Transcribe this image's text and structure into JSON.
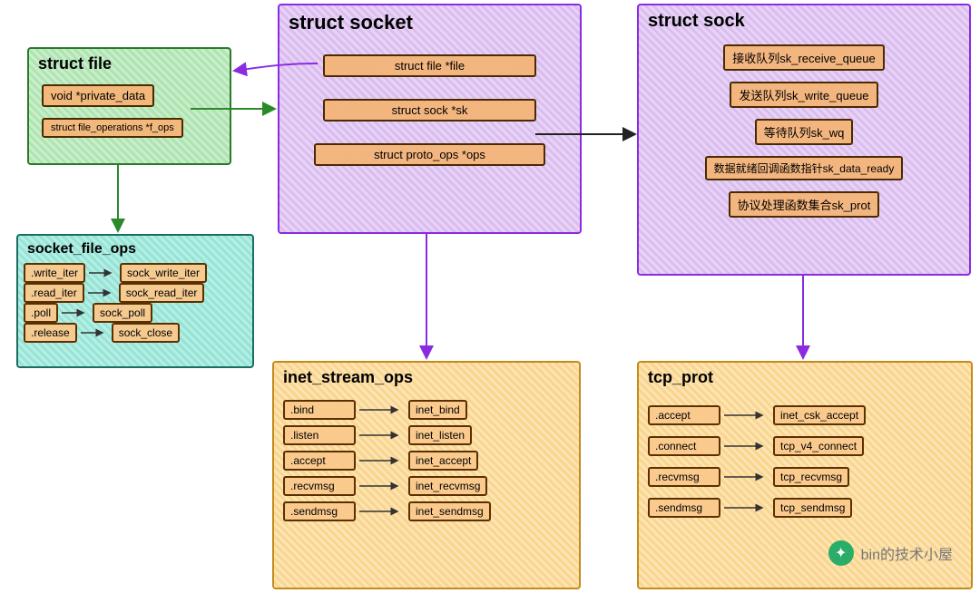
{
  "struct_file": {
    "title": "struct file",
    "fields": [
      "void *private_data",
      "struct file_operations *f_ops"
    ]
  },
  "socket_file_ops": {
    "title": "socket_file_ops",
    "map": [
      [
        ".write_iter",
        "sock_write_iter"
      ],
      [
        ".read_iter",
        "sock_read_iter"
      ],
      [
        ".poll",
        "sock_poll"
      ],
      [
        ".release",
        "sock_close"
      ]
    ]
  },
  "struct_socket": {
    "title": "struct socket",
    "fields": [
      "struct file *file",
      "struct sock *sk",
      "struct proto_ops *ops"
    ]
  },
  "struct_sock": {
    "title": "struct sock",
    "fields": [
      "接收队列sk_receive_queue",
      "发送队列sk_write_queue",
      "等待队列sk_wq",
      "数据就绪回调函数指针sk_data_ready",
      "协议处理函数集合sk_prot"
    ]
  },
  "inet_stream_ops": {
    "title": "inet_stream_ops",
    "map": [
      [
        ".bind",
        "inet_bind"
      ],
      [
        ".listen",
        "inet_listen"
      ],
      [
        ".accept",
        "inet_accept"
      ],
      [
        ".recvmsg",
        "inet_recvmsg"
      ],
      [
        ".sendmsg",
        "inet_sendmsg"
      ]
    ]
  },
  "tcp_prot": {
    "title": "tcp_prot",
    "map": [
      [
        ".accept",
        "inet_csk_accept"
      ],
      [
        ".connect",
        "tcp_v4_connect"
      ],
      [
        ".recvmsg",
        "tcp_recvmsg"
      ],
      [
        ".sendmsg",
        "tcp_sendmsg"
      ]
    ]
  },
  "watermark": "bin的技术小屋",
  "chart_data": {
    "type": "diagram",
    "nodes": [
      {
        "id": "struct_file",
        "label": "struct file",
        "fields": [
          "void *private_data",
          "struct file_operations *f_ops"
        ]
      },
      {
        "id": "socket_file_ops",
        "label": "socket_file_ops",
        "pairs": [
          [
            ".write_iter",
            "sock_write_iter"
          ],
          [
            ".read_iter",
            "sock_read_iter"
          ],
          [
            ".poll",
            "sock_poll"
          ],
          [
            ".release",
            "sock_close"
          ]
        ]
      },
      {
        "id": "struct_socket",
        "label": "struct socket",
        "fields": [
          "struct file *file",
          "struct sock *sk",
          "struct proto_ops *ops"
        ]
      },
      {
        "id": "struct_sock",
        "label": "struct sock",
        "fields": [
          "接收队列sk_receive_queue",
          "发送队列sk_write_queue",
          "等待队列sk_wq",
          "数据就绪回调函数指针sk_data_ready",
          "协议处理函数集合sk_prot"
        ]
      },
      {
        "id": "inet_stream_ops",
        "label": "inet_stream_ops",
        "pairs": [
          [
            ".bind",
            "inet_bind"
          ],
          [
            ".listen",
            "inet_listen"
          ],
          [
            ".accept",
            "inet_accept"
          ],
          [
            ".recvmsg",
            "inet_recvmsg"
          ],
          [
            ".sendmsg",
            "inet_sendmsg"
          ]
        ]
      },
      {
        "id": "tcp_prot",
        "label": "tcp_prot",
        "pairs": [
          [
            ".accept",
            "inet_csk_accept"
          ],
          [
            ".connect",
            "tcp_v4_connect"
          ],
          [
            ".recvmsg",
            "tcp_recvmsg"
          ],
          [
            ".sendmsg",
            "tcp_sendmsg"
          ]
        ]
      }
    ],
    "edges": [
      {
        "from": "struct_file.f_ops",
        "to": "socket_file_ops",
        "color": "green"
      },
      {
        "from": "struct_file.private_data",
        "to": "struct_socket",
        "color": "green"
      },
      {
        "from": "struct_socket.file",
        "to": "struct_file",
        "color": "purple"
      },
      {
        "from": "struct_socket.sk",
        "to": "struct_sock",
        "color": "black"
      },
      {
        "from": "struct_socket.ops",
        "to": "inet_stream_ops",
        "color": "purple"
      },
      {
        "from": "struct_sock.sk_prot",
        "to": "tcp_prot",
        "color": "purple"
      },
      {
        "from": "socket_file_ops.write_iter",
        "to": "sock_write_iter",
        "color": "black"
      },
      {
        "from": "socket_file_ops.read_iter",
        "to": "sock_read_iter",
        "color": "black"
      },
      {
        "from": "socket_file_ops.poll",
        "to": "sock_poll",
        "color": "black"
      },
      {
        "from": "socket_file_ops.release",
        "to": "sock_close",
        "color": "black"
      },
      {
        "from": "inet_stream_ops.bind",
        "to": "inet_bind",
        "color": "black"
      },
      {
        "from": "inet_stream_ops.listen",
        "to": "inet_listen",
        "color": "black"
      },
      {
        "from": "inet_stream_ops.accept",
        "to": "inet_accept",
        "color": "black"
      },
      {
        "from": "inet_stream_ops.recvmsg",
        "to": "inet_recvmsg",
        "color": "black"
      },
      {
        "from": "inet_stream_ops.sendmsg",
        "to": "inet_sendmsg",
        "color": "black"
      },
      {
        "from": "tcp_prot.accept",
        "to": "inet_csk_accept",
        "color": "black"
      },
      {
        "from": "tcp_prot.connect",
        "to": "tcp_v4_connect",
        "color": "black"
      },
      {
        "from": "tcp_prot.recvmsg",
        "to": "tcp_recvmsg",
        "color": "black"
      },
      {
        "from": "tcp_prot.sendmsg",
        "to": "tcp_sendmsg",
        "color": "black"
      }
    ]
  }
}
